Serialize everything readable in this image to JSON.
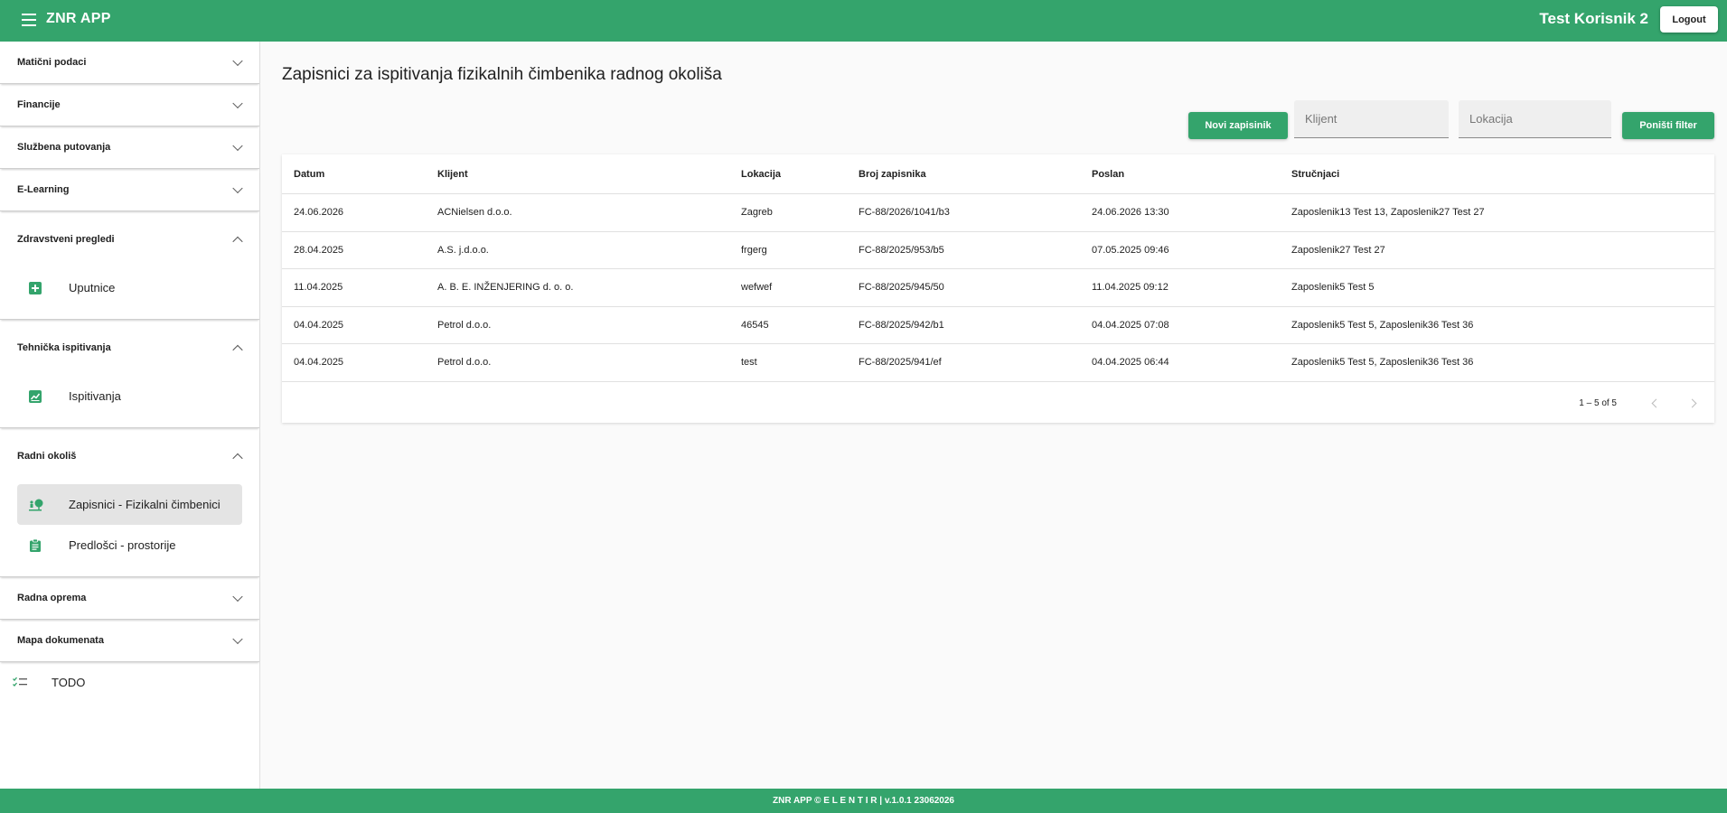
{
  "header": {
    "app_title": "ZNR APP",
    "user_name": "Test Korisnik 2",
    "logout_label": "Logout"
  },
  "sidebar": {
    "sections": [
      {
        "label": "Matični podaci"
      },
      {
        "label": "Financije"
      },
      {
        "label": "Službena putovanja"
      },
      {
        "label": "E-Learning"
      },
      {
        "label": "Zdravstveni pregledi",
        "items": [
          {
            "label": "Uputnice",
            "icon": "plus-box-icon"
          }
        ]
      },
      {
        "label": "Tehnička ispitivanja",
        "items": [
          {
            "label": "Ispitivanja",
            "icon": "chart-icon"
          }
        ]
      },
      {
        "label": "Radni okoliš",
        "items": [
          {
            "label": "Zapisnici - Fizikalni čimbenici",
            "icon": "nature-person-icon",
            "active": true
          },
          {
            "label": "Predlošci - prostorije",
            "icon": "clipboard-icon"
          }
        ]
      },
      {
        "label": "Radna oprema"
      },
      {
        "label": "Mapa dokumenata"
      }
    ],
    "todo_label": "TODO"
  },
  "main": {
    "title": "Zapisnici za ispitivanja fizikalnih čimbenika radnog okoliša",
    "new_button": "Novi zapisinik",
    "filter_klijent_placeholder": "Klijent",
    "filter_lokacija_placeholder": "Lokacija",
    "reset_button": "Poništi filter",
    "table": {
      "columns": [
        "Datum",
        "Klijent",
        "Lokacija",
        "Broj zapisnika",
        "Poslan",
        "Stručnjaci"
      ],
      "rows": [
        [
          "24.06.2026",
          "ACNielsen d.o.o.",
          "Zagreb",
          "FC-88/2026/1041/b3",
          "24.06.2026 13:30",
          "Zaposlenik13 Test 13, Zaposlenik27 Test 27"
        ],
        [
          "28.04.2025",
          "A.S. j.d.o.o.",
          "frgerg",
          "FC-88/2025/953/b5",
          "07.05.2025 09:46",
          "Zaposlenik27 Test 27"
        ],
        [
          "11.04.2025",
          "A. B. E. INŽENJERING d. o. o.",
          "wefwef",
          "FC-88/2025/945/50",
          "11.04.2025 09:12",
          "Zaposlenik5 Test 5"
        ],
        [
          "04.04.2025",
          "Petrol d.o.o.",
          "46545",
          "FC-88/2025/942/b1",
          "04.04.2025 07:08",
          "Zaposlenik5 Test 5, Zaposlenik36 Test 36"
        ],
        [
          "04.04.2025",
          "Petrol d.o.o.",
          "test",
          "FC-88/2025/941/ef",
          "04.04.2025 06:44",
          "Zaposlenik5 Test 5, Zaposlenik36 Test 36"
        ]
      ]
    },
    "paginator": {
      "range_label": "1 – 5 of 5"
    }
  },
  "footer": {
    "text": "ZNR APP © E L E N T I R | v.1.0.1 23062026"
  },
  "colors": {
    "brand": "#34a46c",
    "active_bg": "#e4e4e4"
  }
}
